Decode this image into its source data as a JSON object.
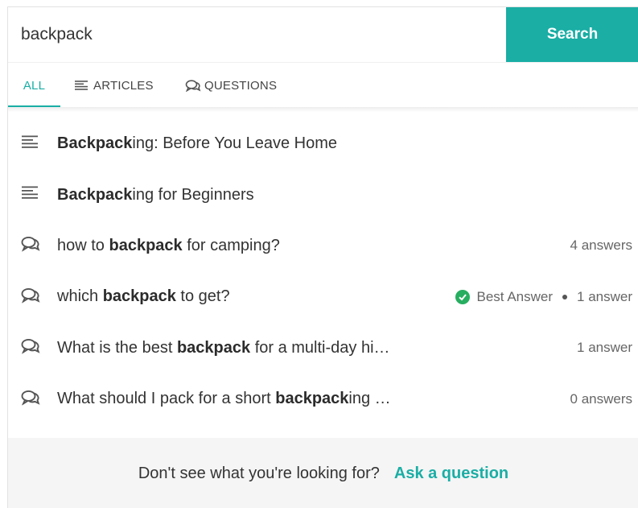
{
  "search": {
    "query": "backpack",
    "button_label": "Search"
  },
  "tabs": [
    {
      "label": "ALL",
      "icon": "none",
      "active": true
    },
    {
      "label": "ARTICLES",
      "icon": "article-lines-icon",
      "active": false
    },
    {
      "label": "QUESTIONS",
      "icon": "speech-bubbles-icon",
      "active": false
    }
  ],
  "colors": {
    "accent": "#1aaea5",
    "success": "#27ae60"
  },
  "results": [
    {
      "type": "article",
      "icon": "article-lines-icon",
      "bold": "Backpack",
      "rest": "ing: Before You Leave Home",
      "pre": "",
      "meta": ""
    },
    {
      "type": "article",
      "icon": "article-lines-icon",
      "bold": "Backpack",
      "rest": "ing for Beginners",
      "pre": "",
      "meta": ""
    },
    {
      "type": "question",
      "icon": "speech-bubbles-icon",
      "pre": "how to ",
      "bold": "backpack",
      "rest": " for camping?",
      "meta": "4 answers"
    },
    {
      "type": "question",
      "icon": "speech-bubbles-icon",
      "pre": "which ",
      "bold": "backpack",
      "rest": " to get?",
      "best_answer": "Best Answer",
      "meta": "1 answer"
    },
    {
      "type": "question",
      "icon": "speech-bubbles-icon",
      "pre": "What is the best ",
      "bold": "backpack",
      "rest": " for a multi-day hi…",
      "meta": "1 answer"
    },
    {
      "type": "question",
      "icon": "speech-bubbles-icon",
      "pre": "What should I pack for a short ",
      "bold": "backpack",
      "rest": "ing …",
      "meta": "0 answers"
    }
  ],
  "footer": {
    "prompt": "Don't see what you're looking for?",
    "link": "Ask a question"
  }
}
